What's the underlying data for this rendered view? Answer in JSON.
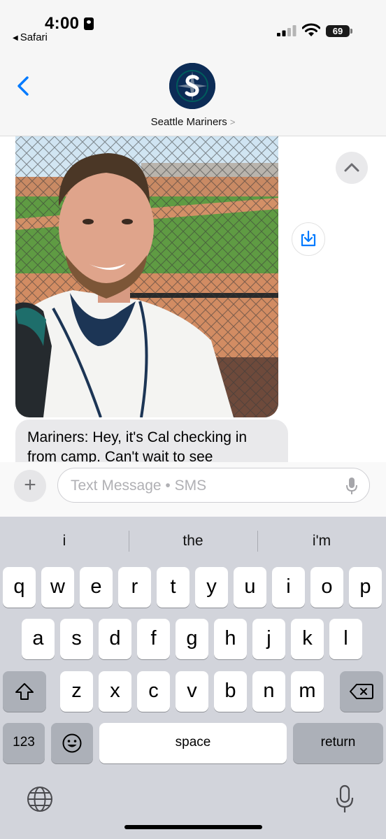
{
  "status_bar": {
    "time": "4:00",
    "back_app": "Safari",
    "battery": "69"
  },
  "header": {
    "contact_name": "Seattle Mariners",
    "chevron": ">",
    "avatar_icon": "seattle-mariners-logo",
    "accent": "#0c2c56"
  },
  "thread": {
    "photo_description_icon": "player-selfie-photo",
    "message_text": "Mariners: Hey, it's Cal checking in from camp. Can't wait to see"
  },
  "compose": {
    "plus_label": "+",
    "placeholder": "Text Message • SMS"
  },
  "keyboard": {
    "suggestions": [
      "i",
      "the",
      "i'm"
    ],
    "row1": [
      "q",
      "w",
      "e",
      "r",
      "t",
      "y",
      "u",
      "i",
      "o",
      "p"
    ],
    "row2": [
      "a",
      "s",
      "d",
      "f",
      "g",
      "h",
      "j",
      "k",
      "l"
    ],
    "row3": [
      "z",
      "x",
      "c",
      "v",
      "b",
      "n",
      "m"
    ],
    "numbers_label": "123",
    "space_label": "space",
    "return_label": "return"
  },
  "colors": {
    "ios_blue": "#007aff",
    "keyboard_bg": "#d2d4db",
    "bubble_bg": "#e9e9eb"
  }
}
